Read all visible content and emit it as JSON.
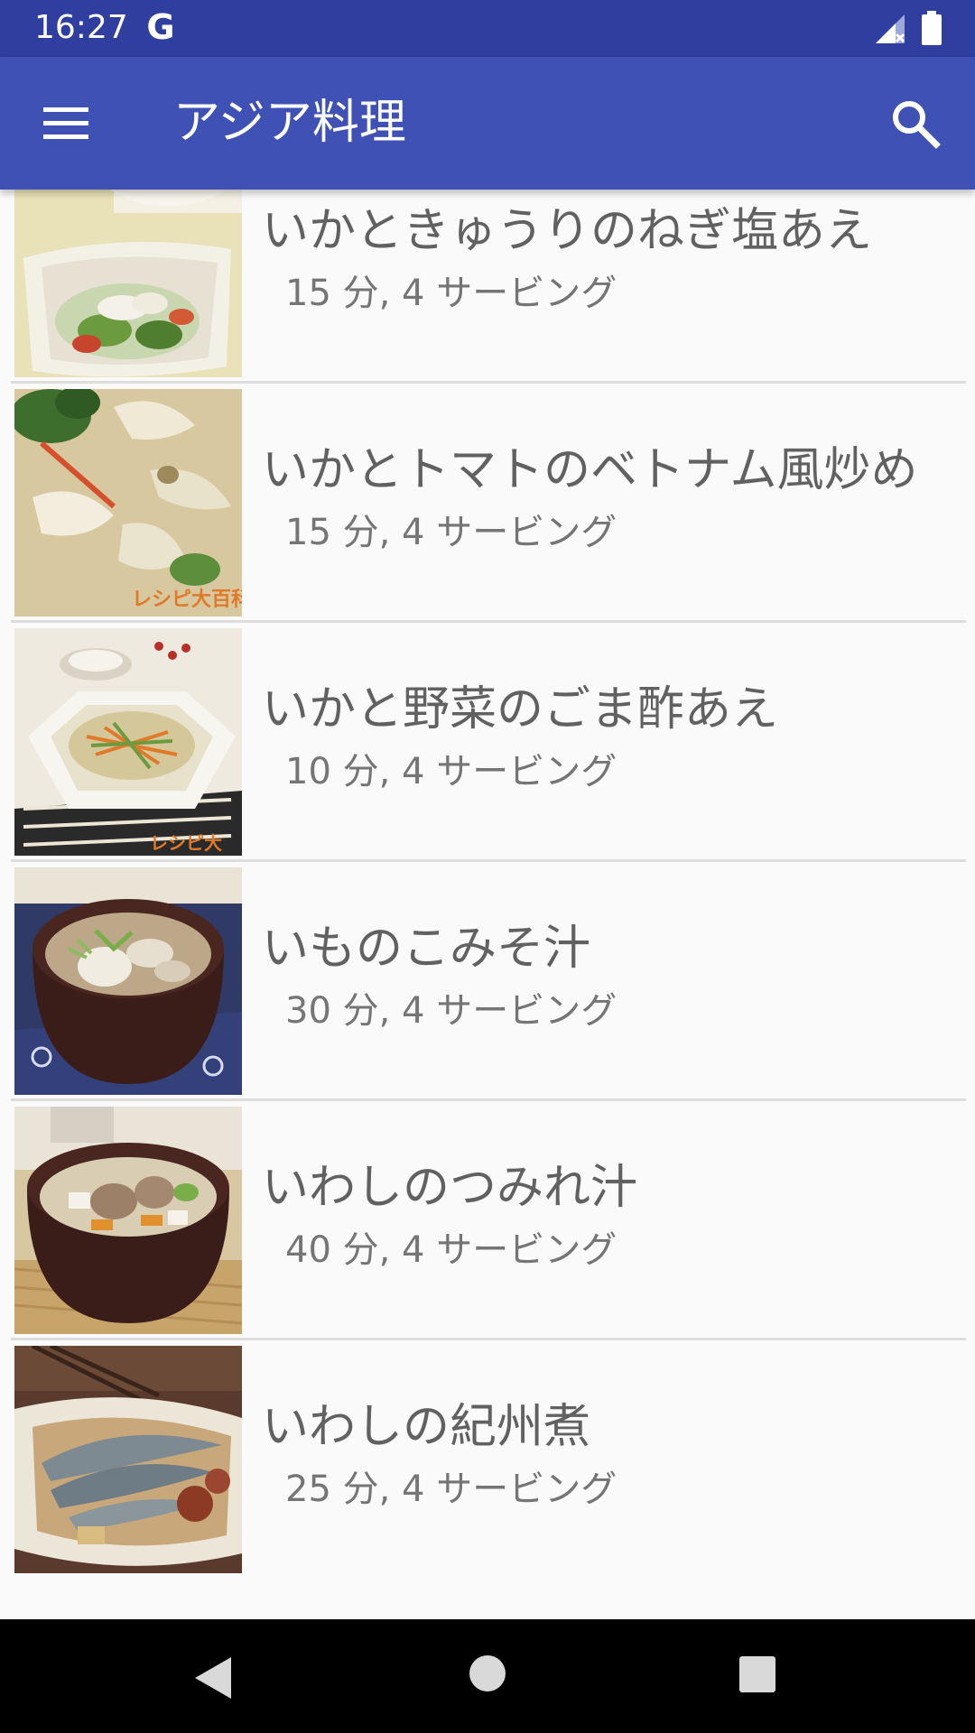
{
  "status_bar": {
    "time": "16:27",
    "g_label": "G",
    "icons": [
      "google-icon",
      "signal-icon",
      "battery-icon"
    ]
  },
  "app_bar": {
    "title": "アジア料理",
    "menu_icon": "menu-icon",
    "search_icon": "search-icon",
    "color": "#3F51B5",
    "status_color": "#303F9F"
  },
  "recipes": [
    {
      "title": "いかときゅうりのねぎ塩あえ",
      "subtitle": "15 分, 4 サービング",
      "image": "squid-cucumber-salad"
    },
    {
      "title": "いかとトマトのベトナム風炒め",
      "subtitle": "15 分, 4 サービング",
      "image": "squid-tomato-stirfry"
    },
    {
      "title": "いかと野菜のごま酢あえ",
      "subtitle": "10 分, 4 サービング",
      "image": "squid-vegetable-sesame"
    },
    {
      "title": "いものこみそ汁",
      "subtitle": "30 分, 4 サービング",
      "image": "taro-miso-soup"
    },
    {
      "title": "いわしのつみれ汁",
      "subtitle": "40 分, 4 サービング",
      "image": "sardine-dumpling-soup"
    },
    {
      "title": "いわしの紀州煮",
      "subtitle": "25 分, 4 サービング",
      "image": "simmered-sardines"
    }
  ],
  "nav_bar": {
    "icons": [
      "back-icon",
      "home-icon",
      "recents-icon"
    ]
  }
}
